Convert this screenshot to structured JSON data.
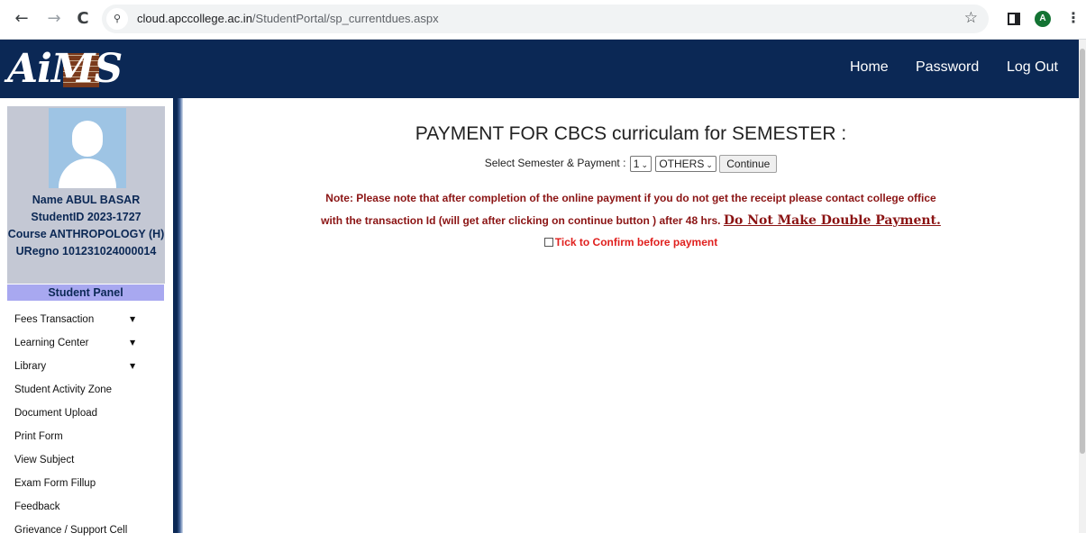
{
  "browser": {
    "back_icon": "←",
    "forward_icon": "→",
    "reload_icon": "C",
    "site_info_icon": "⚲",
    "url_host": "cloud.apccollege.ac.in",
    "url_path": "/StudentPortal/sp_currentdues.aspx",
    "star_icon": "☆",
    "profile_initial": "A",
    "menu_icon": "⋮"
  },
  "header": {
    "logo_text": "AiMS",
    "nav": [
      "Home",
      "Password",
      "Log Out"
    ]
  },
  "student": {
    "name_line": "Name ABUL BASAR",
    "id_line": "StudentID  2023-1727",
    "course_line": "Course  ANTHROPOLOGY (H)",
    "uregno_line": "URegno  101231024000014"
  },
  "sidebar": {
    "panel_title": "Student Panel",
    "items": [
      {
        "label": "Fees Transaction",
        "caret": "▼"
      },
      {
        "label": "Learning Center",
        "caret": "▼"
      },
      {
        "label": "Library",
        "caret": "▼"
      },
      {
        "label": "Student Activity Zone"
      },
      {
        "label": "Document Upload"
      },
      {
        "label": "Print Form"
      },
      {
        "label": "View Subject"
      },
      {
        "label": "Exam Form Fillup"
      },
      {
        "label": "Feedback"
      },
      {
        "label": "Grievance / Support Cell"
      }
    ]
  },
  "main": {
    "title": "PAYMENT FOR CBCS curriculam for SEMESTER :",
    "select_label": "Select Semester & Payment :",
    "semester_value": "1",
    "payment_value": "OTHERS",
    "continue_label": "Continue",
    "note_line1": "Note: Please note that after completion of the online payment if you do not get the receipt please contact college office",
    "note_line2": "with the transaction Id (will get after clicking on continue button ) after 48 hrs.",
    "note_emphasis": "Do Not Make Double Payment.",
    "confirm_label": "Tick to Confirm before payment",
    "dropdown_arrow": "⌄"
  },
  "colors": {
    "header_bg": "#0b2855",
    "note_text": "#8b1414",
    "confirm_text": "#e0201e",
    "panel_title_bg": "#a8a8f0"
  }
}
